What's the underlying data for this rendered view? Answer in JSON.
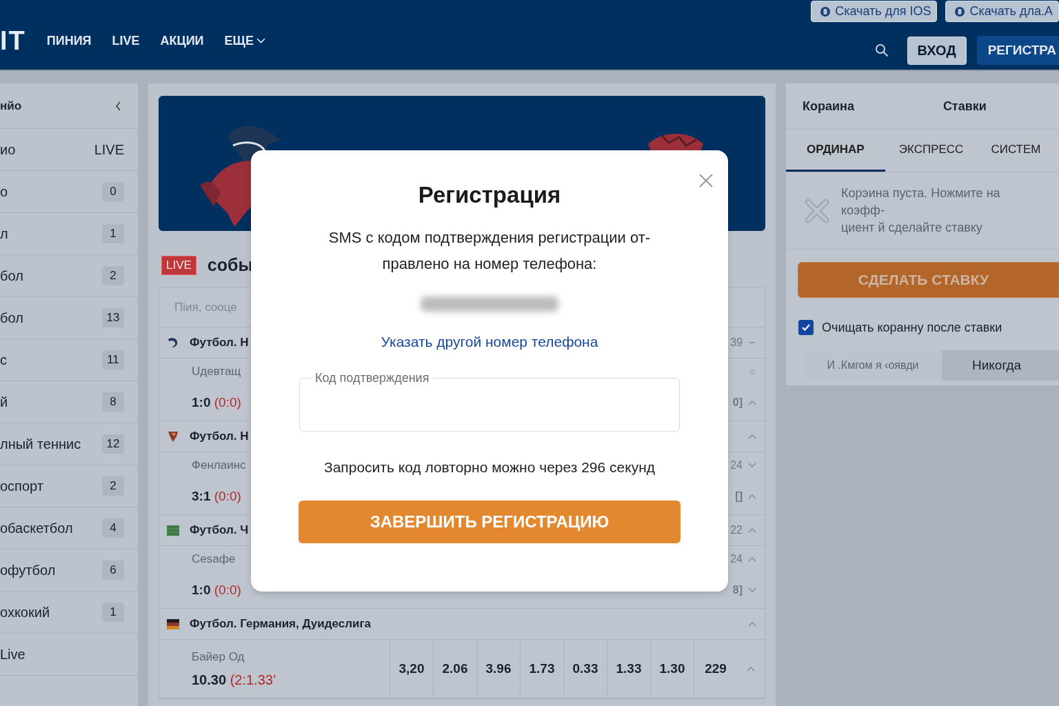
{
  "header": {
    "logo": "IT",
    "nav": [
      {
        "label": "ПИНИЯ",
        "dropdown": false
      },
      {
        "label": "LIVE",
        "dropdown": false
      },
      {
        "label": "АКЦИИ",
        "dropdown": false
      },
      {
        "label": "ЕЩЕ",
        "dropdown": true
      }
    ],
    "downloads": [
      "Скачать для IOS",
      "Скачать дла.А"
    ],
    "login": "ВХОД",
    "register": "РЕГИСТРА"
  },
  "sidebar": {
    "title": "нйо",
    "subheader": {
      "label": "ио",
      "live": "LIVE"
    },
    "items": [
      {
        "label": "о",
        "count": "0"
      },
      {
        "label": "л",
        "count": "1"
      },
      {
        "label": "бол",
        "count": "2"
      },
      {
        "label": "бол",
        "count": "13"
      },
      {
        "label": "с",
        "count": "11"
      },
      {
        "label": "й",
        "count": "8"
      },
      {
        "label": "лный теннис",
        "count": "12"
      },
      {
        "label": "оспорт",
        "count": "2"
      },
      {
        "label": "обаскетбол",
        "count": "4"
      },
      {
        "label": "офутбол",
        "count": "6"
      },
      {
        "label": "охкокий",
        "count": "1"
      }
    ],
    "footer": "Live"
  },
  "main": {
    "live_badge": "LIVE",
    "title": "собы",
    "table": {
      "header": "Пiия,  сооце",
      "groups": [
        {
          "kind": "swirl",
          "title": "Футбол. Н",
          "team": "Uдевтащ",
          "score": "1:0",
          "score_detail": "(0:0)",
          "side": [
            {
              "text": "39",
              "kind": "dash"
            },
            {
              "kind": "dot"
            },
            {
              "text": "0]",
              "kind": "up"
            }
          ]
        },
        {
          "kind": "shield",
          "title": "Футбол. Н",
          "team": "Фенлаинс",
          "score": "3:1",
          "score_detail": "(0:0)",
          "side": [
            {
              "kind": "up"
            },
            {
              "text": "24",
              "kind": "down"
            },
            {
              "text": "[]",
              "kind": "up"
            }
          ]
        },
        {
          "kind": "green",
          "title": "Футбол. Ч",
          "team": "Сеѕафе",
          "score": "1:0",
          "score_detail": "(0:0)",
          "side": [
            {
              "text": "22",
              "kind": "up"
            },
            {
              "text": "24",
              "kind": "up"
            },
            {
              "text": "8]",
              "kind": "down"
            }
          ]
        },
        {
          "kind": "flag",
          "title": "Футбол. Германия, Дуидеслига",
          "team": "Байер Од",
          "score": "10.30",
          "score_detail": "(2:1.33’",
          "odds": [
            "3,20",
            "2.06",
            "3.96",
            "1.73",
            "0.33",
            "1.33",
            "1.30",
            "229"
          ],
          "side": [
            {
              "kind": "up"
            },
            {
              "kind": "up"
            }
          ]
        }
      ]
    }
  },
  "bet_slip": {
    "tabs": [
      "Кораина",
      "Ставки"
    ],
    "bet_types": [
      {
        "label": "ОРДИНАР",
        "selected": true
      },
      {
        "label": "ЭКСПРЕСС",
        "selected": false
      },
      {
        "label": "СИСТЕМ",
        "selected": false
      }
    ],
    "empty_message": "Корэина пуста. Ножмите на коэфф-\nциент й сделайте ставку",
    "place_bet": "СДЕЛАТЬ СТАВКУ",
    "clear_after": {
      "label": "Очищать коранну после ставки",
      "checked": true
    },
    "accept_options": [
      {
        "label": "И .Кмгом я ‹оявди",
        "selected": false
      },
      {
        "label": "Никогда",
        "selected": true
      }
    ]
  },
  "modal": {
    "title": "Регистрация",
    "message": "SMS с кодом подтверждения регистрации от-\nправлено на номер телефона:",
    "change_phone_link": "Указать другой номер телефона",
    "code_field": {
      "label": "Код подтверждения"
    },
    "resend_note": "Запросить код ловторно можно через 296 секунд",
    "submit": "ЗАВЕРШИТЬ РЕГИСТРАЦИЮ"
  }
}
